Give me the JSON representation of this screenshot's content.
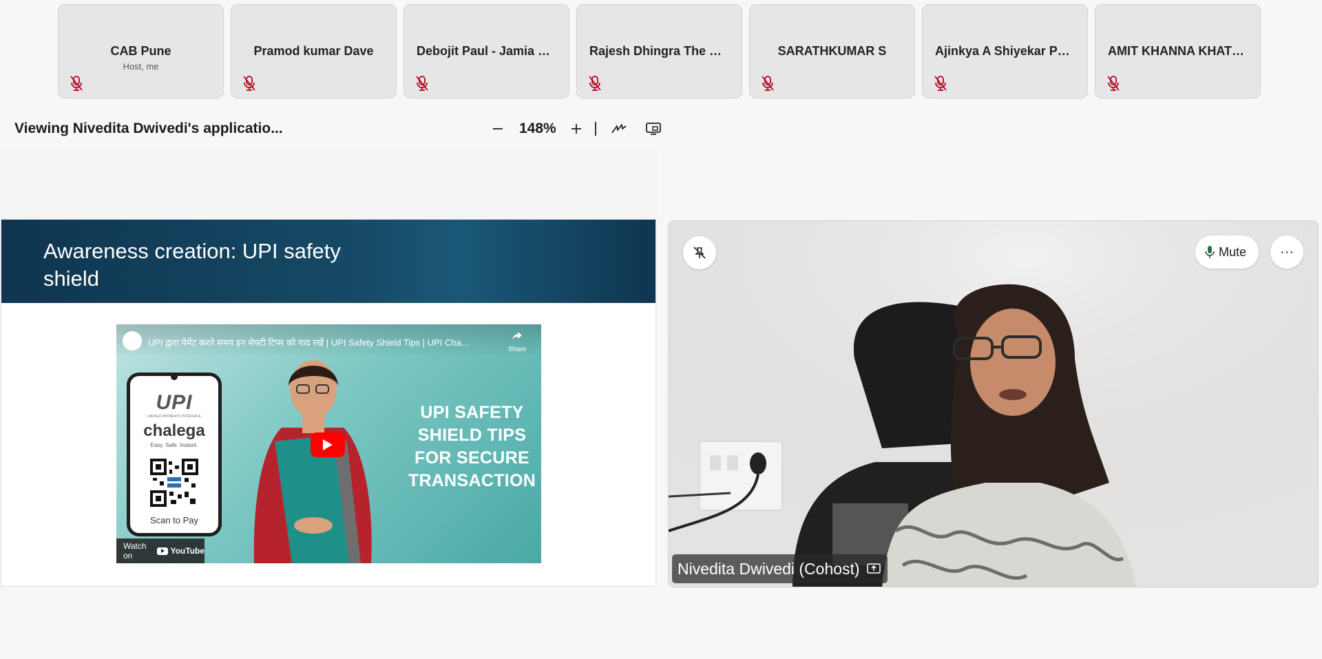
{
  "participants": [
    {
      "name": "CAB Pune",
      "role": "Host, me",
      "muted": true
    },
    {
      "name": "Pramod kumar Dave",
      "role": "",
      "muted": true
    },
    {
      "name": "Debojit Paul - Jamia Co...",
      "role": "",
      "muted": true
    },
    {
      "name": "Rajesh Dhingra The Vai...",
      "role": "",
      "muted": true
    },
    {
      "name": "SARATHKUMAR S",
      "role": "",
      "muted": true
    },
    {
      "name": "Ajinkya A Shiyekar Patil",
      "role": "",
      "muted": true
    },
    {
      "name": "AMIT KHANNA KHATT...",
      "role": "",
      "muted": true
    }
  ],
  "toolbar": {
    "viewing_title": "Viewing Nivedita Dwivedi's applicatio...",
    "zoom_level": "148%",
    "icons": [
      "zoom-out-icon",
      "zoom-in-icon",
      "annotate-icon",
      "pop-out-icon"
    ]
  },
  "slide": {
    "heading": "Awareness creation: UPI safety shield",
    "video": {
      "title": "UPI द्वारा पेमेंट करते समय इन सेफ्टी टिप्स को याद रखें | UPI Safety Shield Tips | UPI Chalega",
      "share_label": "Share",
      "phone_logo": "UPI",
      "phone_logo_sub": "UNIFIED PAYMENTS INTERFACE",
      "phone_brand": "chalega",
      "phone_tagline": "Easy. Safe. Instant.",
      "phone_scan": "Scan to Pay",
      "caption": "UPI SAFETY SHIELD TIPS FOR SECURE TRANSACTION",
      "watch_on": "Watch on",
      "youtube_label": "YouTube"
    }
  },
  "video_tile": {
    "participant_name": "Nivedita Dwivedi (Cohost)",
    "mute_label": "Mute",
    "more_label": "···",
    "mic_color": "#1f7a3f"
  },
  "colors": {
    "muted_mic": "#b3001b",
    "banner": "#0f3550",
    "youtube_red": "#ff0000"
  }
}
